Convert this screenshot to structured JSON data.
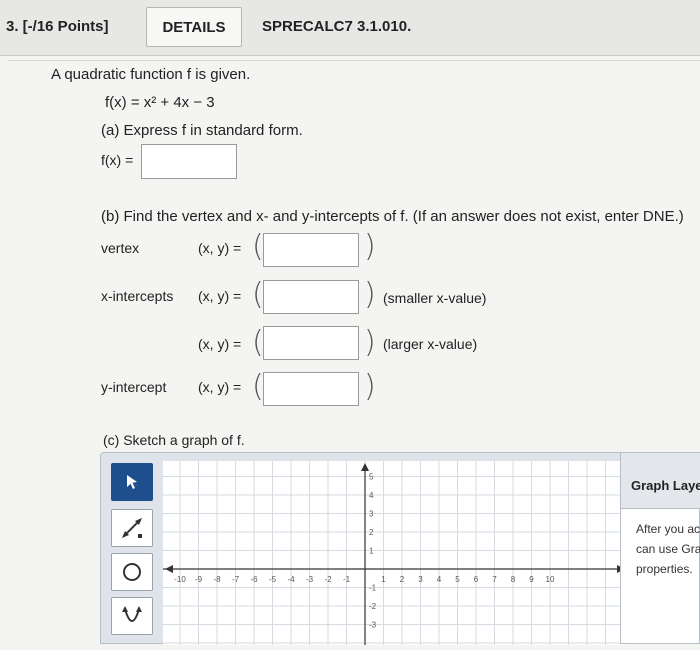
{
  "header": {
    "question_number": "3. [-/16 Points]",
    "details_label": "DETAILS",
    "problem_code": "SPRECALC7 3.1.010."
  },
  "problem": {
    "intro": "A quadratic function f is given.",
    "function": "f(x) = x² + 4x − 3",
    "part_a": {
      "prompt": "(a) Express f in standard form.",
      "answer_label": "f(x) =",
      "answer_value": ""
    },
    "part_b": {
      "prompt": "(b) Find the vertex and x- and y-intercepts of f. (If an answer does not exist, enter DNE.)",
      "rows": [
        {
          "label": "vertex",
          "coord": "(x, y) =",
          "value": "",
          "note": ""
        },
        {
          "label": "x-intercepts",
          "coord": "(x, y) =",
          "value": "",
          "note": "(smaller x-value)"
        },
        {
          "label": "",
          "coord": "(x, y) =",
          "value": "",
          "note": "(larger x-value)"
        },
        {
          "label": "y-intercept",
          "coord": "(x, y) =",
          "value": "",
          "note": ""
        }
      ]
    },
    "part_c": {
      "prompt": "(c) Sketch a graph of f."
    }
  },
  "graph_tool": {
    "tools": [
      {
        "name": "select",
        "icon": "arrow-pointer-icon"
      },
      {
        "name": "line",
        "icon": "line-tool-icon"
      },
      {
        "name": "circle",
        "icon": "circle-tool-icon"
      },
      {
        "name": "parabola",
        "icon": "parabola-tool-icon"
      }
    ],
    "x_ticks": [
      "-10",
      "-9",
      "-8",
      "-7",
      "-6",
      "-5",
      "-4",
      "-3",
      "-2",
      "-1",
      "1",
      "2",
      "3",
      "4",
      "5",
      "6",
      "7",
      "8",
      "9",
      "10"
    ],
    "y_ticks_positive": [
      "1",
      "2",
      "3",
      "4",
      "5"
    ],
    "y_ticks_negative": [
      "-1",
      "-2",
      "-3"
    ],
    "active_tool_color": "#1f4e8c"
  },
  "side_panel": {
    "title": "Graph Laye",
    "body_lines": [
      "After you ac",
      "can use Gra",
      "properties."
    ]
  }
}
